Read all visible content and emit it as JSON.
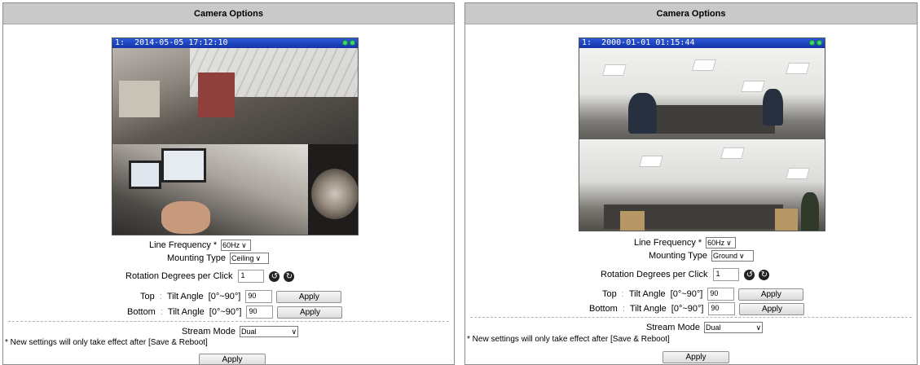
{
  "panels": [
    {
      "title": "Camera Options",
      "video": {
        "channel": "1:",
        "timestamp": "2014-05-05 17:12:10"
      },
      "line_frequency": {
        "label": "Line Frequency",
        "required": "*",
        "value": "60Hz"
      },
      "mounting_type": {
        "label": "Mounting Type",
        "value": "Ceiling"
      },
      "rotation": {
        "label": "Rotation Degrees per Click",
        "value": "1"
      },
      "top_tilt": {
        "position": "Top",
        "sep": ":",
        "label": "Tilt Angle",
        "range": "[0°~90°]",
        "value": "90",
        "apply": "Apply"
      },
      "bottom_tilt": {
        "position": "Bottom",
        "sep": ":",
        "label": "Tilt Angle",
        "range": "[0°~90°]",
        "value": "90",
        "apply": "Apply"
      },
      "stream_mode": {
        "label": "Stream Mode",
        "value": "Dual"
      },
      "note": "* New settings will only take effect after [Save & Reboot]",
      "apply": "Apply"
    },
    {
      "title": "Camera Options",
      "video": {
        "channel": "1:",
        "timestamp": "2000-01-01 01:15:44"
      },
      "line_frequency": {
        "label": "Line Frequency",
        "required": "*",
        "value": "60Hz"
      },
      "mounting_type": {
        "label": "Mounting Type",
        "value": "Ground"
      },
      "rotation": {
        "label": "Rotation Degrees per Click",
        "value": "1"
      },
      "top_tilt": {
        "position": "Top",
        "sep": ":",
        "label": "Tilt Angle",
        "range": "[0°~90°]",
        "value": "90",
        "apply": "Apply"
      },
      "bottom_tilt": {
        "position": "Bottom",
        "sep": ":",
        "label": "Tilt Angle",
        "range": "[0°~90°]",
        "value": "90",
        "apply": "Apply"
      },
      "stream_mode": {
        "label": "Stream Mode",
        "value": "Dual"
      },
      "note": "* New settings will only take effect after [Save & Reboot]",
      "apply": "Apply"
    }
  ],
  "icons": {
    "rotate_ccw": "rotate-left-icon",
    "rotate_cw": "rotate-right-icon",
    "dropdown": "chevron-down-icon"
  },
  "colors": {
    "header_bg": "#c9c9c9",
    "osd_bar": "#2b59d8",
    "osd_status": "#3ed66a"
  }
}
